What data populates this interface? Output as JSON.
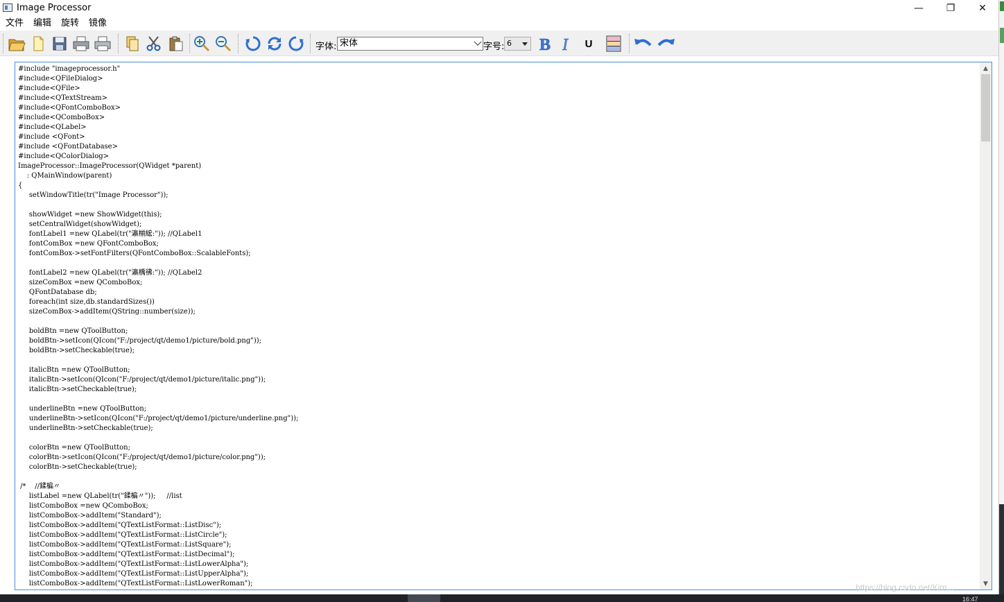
{
  "window": {
    "title": "Image Processor",
    "minimize_glyph": "—",
    "maximize_glyph": "❐",
    "close_glyph": "✕"
  },
  "menu": [
    "文件",
    "编辑",
    "旋转",
    "镜像"
  ],
  "toolbar": {
    "icons": [
      "open-icon",
      "new-file-icon",
      "save-icon",
      "print-text-icon",
      "print-image-icon",
      "copy-icon",
      "cut-icon",
      "paste-icon",
      "zoom-in-icon",
      "zoom-out-icon",
      "rotate-90-icon",
      "rotate-180-icon",
      "rotate-270-icon",
      "bold-icon",
      "italic-icon",
      "underline-icon",
      "color-icon",
      "undo-icon",
      "redo-icon"
    ],
    "font_label": "字体:",
    "font_value": "宋体",
    "size_label": "字号:",
    "size_value": "6",
    "underline_text": "U"
  },
  "editor": {
    "lines": [
      "#include \"imageprocessor.h\"",
      "#include<QFileDialog>",
      "#include<QFile>",
      "#include<QTextStream>",
      "#include<QFontComboBox>",
      "#include<QComboBox>",
      "#include<QLabel>",
      "#include <QFont>",
      "#include <QFontDatabase>",
      "#include<QColorDialog>",
      "ImageProcessor::ImageProcessor(QWidget *parent)",
      "    : QMainWindow(parent)",
      "{",
      "     setWindowTitle(tr(\"Image Processor\"));",
      "",
      "     showWidget =new ShowWidget(this);",
      "     setCentralWidget(showWidget);",
      "     fontLabel1 =new QLabel(tr(\"瀛椾綋:\")); //QLabel1",
      "     fontComBox =new QFontComboBox;",
      "     fontComBox->setFontFilters(QFontComboBox::ScalableFonts);",
      "",
      "     fontLabel2 =new QLabel(tr(\"瀛楀彿:\")); //QLabel2",
      "     sizeComBox =new QComboBox;",
      "     QFontDatabase db;",
      "     foreach(int size,db.standardSizes())",
      "     sizeComBox->addItem(QString::number(size));",
      "",
      "     boldBtn =new QToolButton;",
      "     boldBtn->setIcon(QIcon(\"F:/project/qt/demo1/picture/bold.png\"));",
      "     boldBtn->setCheckable(true);",
      "",
      "     italicBtn =new QToolButton;",
      "     italicBtn->setIcon(QIcon(\"F:/project/qt/demo1/picture/italic.png\"));",
      "     italicBtn->setCheckable(true);",
      "",
      "     underlineBtn =new QToolButton;",
      "     underlineBtn->setIcon(QIcon(\"F:/project/qt/demo1/picture/underline.png\"));",
      "     underlineBtn->setCheckable(true);",
      "",
      "     colorBtn =new QToolButton;",
      "     colorBtn->setIcon(QIcon(\"F:/project/qt/demo1/picture/color.png\"));",
      "     colorBtn->setCheckable(true);",
      "",
      " /*    //鍒楄〃",
      "     listLabel =new QLabel(tr(\"鍒楄〃\"));     //list",
      "     listComboBox =new QComboBox;",
      "     listComboBox->addItem(\"Standard\");",
      "     listComboBox->addItem(\"QTextListFormat::ListDisc\");",
      "     listComboBox->addItem(\"QTextListFormat::ListCircle\");",
      "     listComboBox->addItem(\"QTextListFormat::ListSquare\");",
      "     listComboBox->addItem(\"QTextListFormat::ListDecimal\");",
      "     listComboBox->addItem(\"QTextListFormat::ListLowerAlpha\");",
      "     listComboBox->addItem(\"QTextListFormat::ListUpperAlpha\");",
      "     listComboBox->addItem(\"QTextListFormat::ListLowerRoman\");"
    ]
  },
  "watermark": "https://blog.csdn.net/Kim...",
  "clock": "16:47",
  "colors": {
    "editor_border": "#4d8fd8",
    "toolbar_bg": "#f0f0f0",
    "icon_blue": "#2f6fcf",
    "folder_yellow": "#e8b64a"
  }
}
